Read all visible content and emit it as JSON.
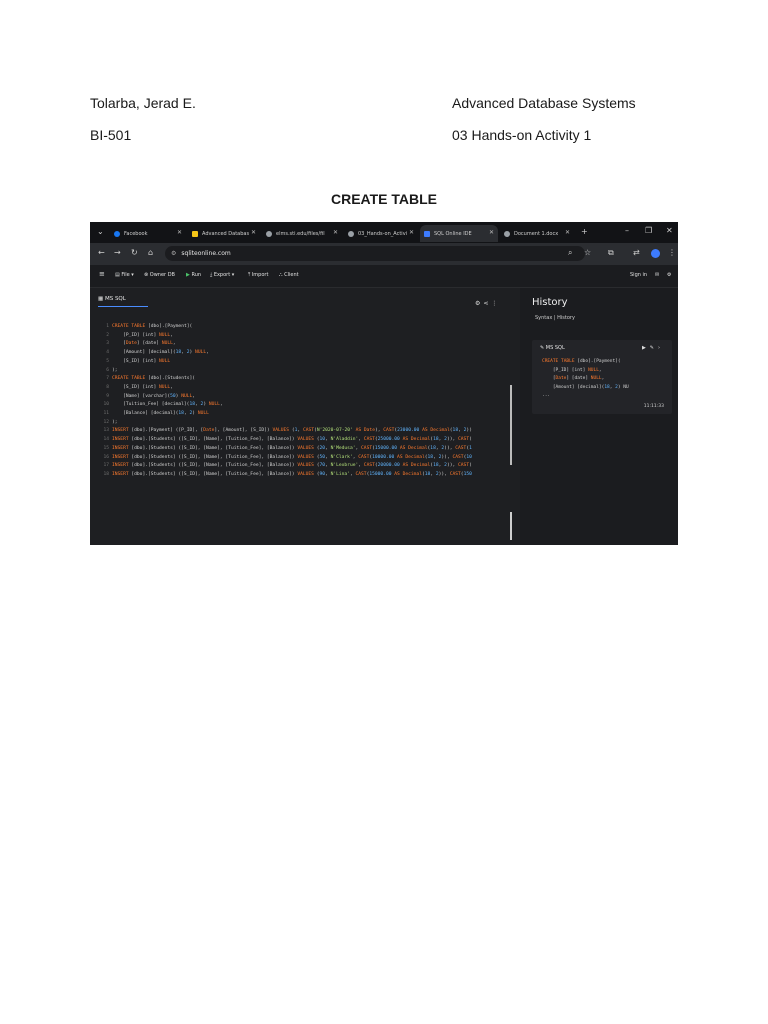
{
  "header": {
    "name": "Tolarba, Jerad E.",
    "section": "BI-501",
    "course": "Advanced Database Systems",
    "activity": "03 Hands-on Activity 1"
  },
  "section_title": "CREATE TABLE",
  "screenshot": {
    "tabs": [
      {
        "label": "Facebook",
        "color": "#1877f2",
        "active": false
      },
      {
        "label": "Advanced Databas",
        "color": "#f5c518",
        "active": false
      },
      {
        "label": "elms.sti.edu/files/fil",
        "color": "#9aa0a6",
        "active": false
      },
      {
        "label": "03_Hands-on_Activi",
        "color": "#9aa0a6",
        "active": false
      },
      {
        "label": "SQL Online IDE",
        "color": "#3d7bfd",
        "active": true
      },
      {
        "label": "Document 1.docx",
        "color": "#9aa0a6",
        "active": false
      }
    ],
    "url": "sqliteonline.com",
    "menu": {
      "file": "File",
      "owner": "Owner DB",
      "run": "Run",
      "export": "Export",
      "import": "Import",
      "client": "Client",
      "signin": "Sign in"
    },
    "editor_tab": "MS SQL",
    "code_lines": [
      "CREATE TABLE [dbo].[Payment](",
      "    [P_ID] [int] NULL,",
      "    [Date] [date] NULL,",
      "    [Amount] [decimal](18, 2) NULL,",
      "    [S_ID] [int] NULL",
      ");",
      "CREATE TABLE [dbo].[Students](",
      "    [S_ID] [int] NULL,",
      "    [Name] [varchar](50) NULL,",
      "    [Tuition_Fee] [decimal](18, 2) NULL,",
      "    [Balance] [decimal](18, 2) NULL",
      ");",
      "INSERT [dbo].[Payment] ([P_ID], [Date], [Amount], [S_ID]) VALUES (1, CAST(N'2020-07-20' AS Date), CAST(23000.00 AS Decimal(18, 2))",
      "INSERT [dbo].[Students] ([S_ID], [Name], [Tuition_Fee], [Balance]) VALUES (10, N'Aladdin', CAST(25000.00 AS Decimal(18, 2)), CAST(",
      "INSERT [dbo].[Students] ([S_ID], [Name], [Tuition_Fee], [Balance]) VALUES (20, N'Medusa', CAST(15000.00 AS Decimal(18, 2)), CAST(1",
      "INSERT [dbo].[Students] ([S_ID], [Name], [Tuition_Fee], [Balance]) VALUES (50, N'Clark', CAST(10000.00 AS Decimal(18, 2)), CAST(10",
      "INSERT [dbo].[Students] ([S_ID], [Name], [Tuition_Fee], [Balance]) VALUES (70, N'Lexbrue', CAST(20000.00 AS Decimal(18, 2)), CAST(",
      "INSERT [dbo].[Students] ([S_ID], [Name], [Tuition_Fee], [Balance]) VALUES (90, N'Lina', CAST(15000.00 AS Decimal(18, 2)), CAST(150"
    ],
    "history": {
      "title": "History",
      "subtitle": "Syntax | History",
      "entry_label": "MS SQL",
      "entry_code": [
        "CREATE TABLE [dbo].[Payment](",
        "    [P_ID] [int] NULL,",
        "    [Date] [date] NULL,",
        "    [Amount] [decimal](18, 2) NU",
        "..."
      ],
      "time": "11:11:33"
    },
    "console_prompt": "$"
  }
}
